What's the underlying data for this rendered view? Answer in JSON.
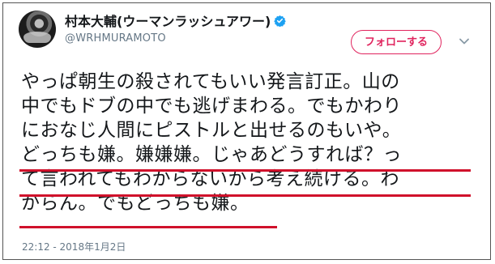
{
  "tweet": {
    "display_name": "村本大輔(ウーマンラッシュアワー)",
    "username": "@WRHMURAMOTO",
    "follow_label": "フォローする",
    "text_lines": [
      "やっぱ朝生の殺されてもいい発言訂正。山の",
      "中でもドブの中でも逃げまわる。でもかわり",
      "におなじ人間にピストルと出せるのもいや。",
      "どっちも嫌。嫌嫌嫌。じゃあどうすれば？っ",
      "て言われてもわからないから考え続ける。わ",
      "からん。でもどっちも嫌。"
    ],
    "timestamp": "22:12 - 2018年1月2日"
  },
  "icons": {
    "avatar": "profile-photo",
    "verified": "verified-badge-icon",
    "menu": "chevron-down-icon"
  },
  "colors": {
    "follow_accent": "#e0245e",
    "verified_blue": "#1da1f2",
    "underline_red": "#d0112b",
    "text": "#14171a",
    "muted": "#657786"
  }
}
